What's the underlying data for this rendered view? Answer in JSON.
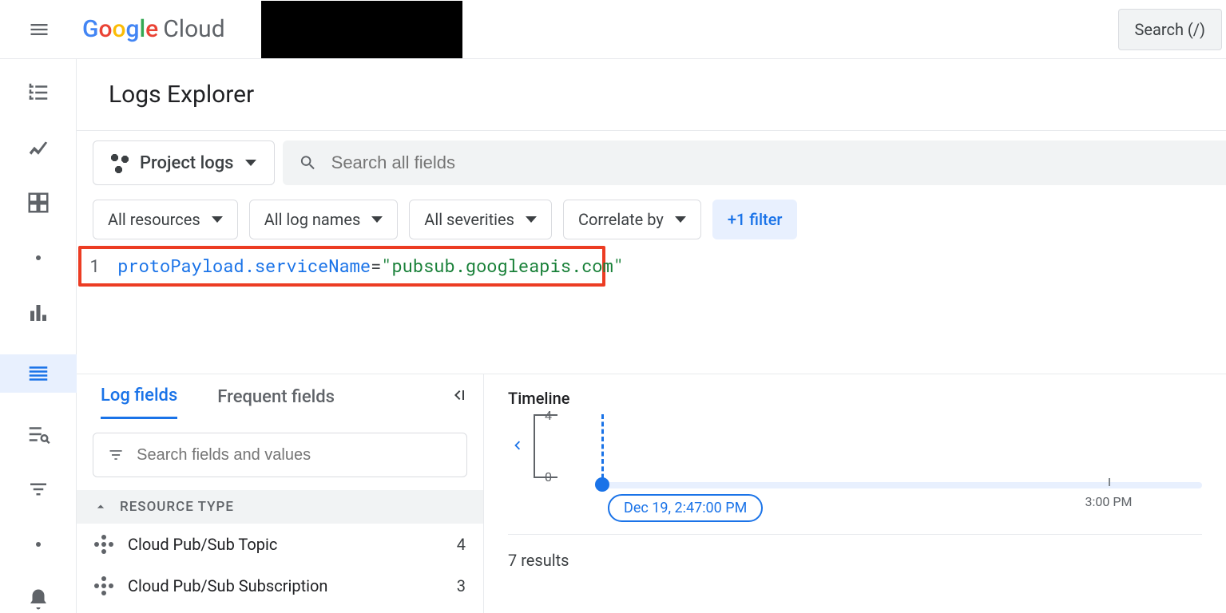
{
  "header": {
    "brand": "Google Cloud",
    "search_button": "Search (/)"
  },
  "page": {
    "title": "Logs Explorer"
  },
  "toolbar": {
    "scope": "Project logs",
    "search_placeholder": "Search all fields"
  },
  "filters": {
    "resources": "All resources",
    "lognames": "All log names",
    "severities": "All severities",
    "correlate": "Correlate by",
    "plus_filter": "+1 filter"
  },
  "query": {
    "line_number": "1",
    "key": "protoPayload.serviceName",
    "eq": "=",
    "value": "\"pubsub.googleapis.com\""
  },
  "tabs": {
    "log_fields": "Log fields",
    "frequent_fields": "Frequent fields"
  },
  "field_search_placeholder": "Search fields and values",
  "section": {
    "resource_type": "RESOURCE TYPE"
  },
  "resources": [
    {
      "label": "Cloud Pub/Sub Topic",
      "count": "4"
    },
    {
      "label": "Cloud Pub/Sub Subscription",
      "count": "3"
    }
  ],
  "timeline": {
    "title": "Timeline",
    "y_max": "4",
    "y_min": "0",
    "marker": "Dec 19, 2:47:00 PM",
    "tick_300": "3:00 PM"
  },
  "results": "7 results"
}
